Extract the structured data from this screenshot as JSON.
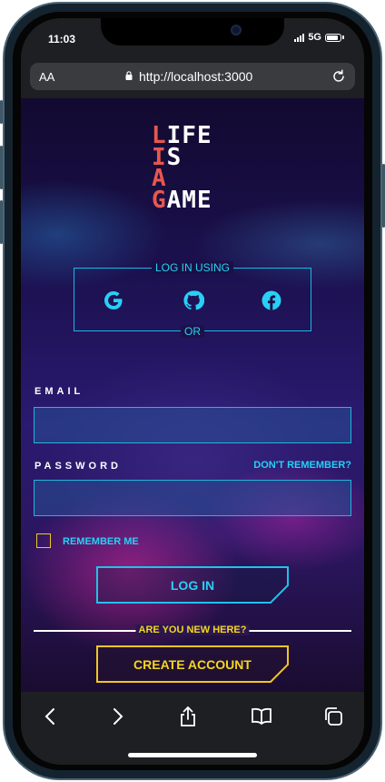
{
  "status": {
    "time": "11:03",
    "network": "5G"
  },
  "browser": {
    "aa_label": "AA",
    "url": "http://localhost:3000"
  },
  "logo": {
    "lines": [
      {
        "first": "L",
        "rest": "IFE"
      },
      {
        "first": "I",
        "rest": "S"
      },
      {
        "first": "A",
        "rest": ""
      },
      {
        "first": "G",
        "rest": "AME"
      }
    ]
  },
  "social_login": {
    "heading": "LOG IN USING",
    "or_label": "OR",
    "providers": [
      "google-icon",
      "github-icon",
      "facebook-icon"
    ]
  },
  "form": {
    "email_label": "EMAIL",
    "email_value": "",
    "password_label": "PASSWORD",
    "password_value": "",
    "forgot_label": "DON'T REMEMBER?",
    "remember_label": "REMEMBER ME",
    "remember_checked": false,
    "login_button": "LOG IN"
  },
  "signup": {
    "prompt": "ARE YOU NEW HERE?",
    "create_button": "CREATE ACCOUNT"
  },
  "colors": {
    "accent_cyan": "#28d0f5",
    "accent_yellow": "#f5d61c",
    "logo_red": "#e8574e"
  }
}
